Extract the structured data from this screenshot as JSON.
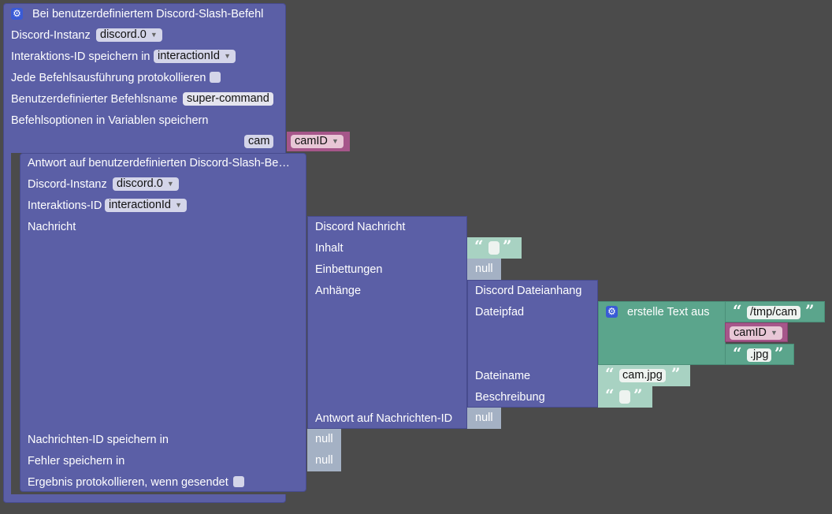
{
  "outer": {
    "title": "Bei benutzerdefiniertem Discord-Slash-Befehl",
    "instance_label": "Discord-Instanz",
    "instance_value": "discord.0",
    "interaction_label": "Interaktions-ID speichern in",
    "interaction_value": "interactionId",
    "log_label": "Jede Befehlsausführung protokollieren",
    "cmdname_label": "Benutzerdefinierter Befehlsname",
    "cmdname_value": "super-command",
    "options_label": "Befehlsoptionen in Variablen speichern",
    "option_name": "cam",
    "option_var": "camID"
  },
  "reply": {
    "title": "Antwort auf benutzerdefinierten Discord-Slash-Be…",
    "instance_label": "Discord-Instanz",
    "instance_value": "discord.0",
    "interaction_label": "Interaktions-ID",
    "interaction_value": "interactionId",
    "message_label": "Nachricht",
    "msgid_label": "Nachrichten-ID speichern in",
    "error_label": "Fehler speichern in",
    "log_label": "Ergebnis protokollieren, wenn gesendet",
    "null1": "null",
    "null2": "null"
  },
  "message": {
    "title": "Discord Nachricht",
    "content_label": "Inhalt",
    "embeds_label": "Einbettungen",
    "embeds_value": "null",
    "attachments_label": "Anhänge",
    "reply_label": "Antwort auf Nachrichten-ID",
    "reply_value": "null"
  },
  "attachment": {
    "title": "Discord Dateianhang",
    "path_label": "Dateipfad",
    "name_label": "Dateiname",
    "name_value": "cam.jpg",
    "desc_label": "Beschreibung"
  },
  "join": {
    "label": "erstelle Text aus",
    "part1": "/tmp/cam",
    "var": "camID",
    "part3": ".jpg"
  },
  "quote_open": "“",
  "quote_close": "”",
  "dropdown_arrow": "▼",
  "gear_icon": "⚙",
  "colors": {
    "purple": "#5b5fa6",
    "teal": "#5ba58c",
    "teal_light": "#a8d2c2",
    "null_gray": "#a4b1c4",
    "var_pink": "#a6568a",
    "background": "#4b4b4b"
  }
}
